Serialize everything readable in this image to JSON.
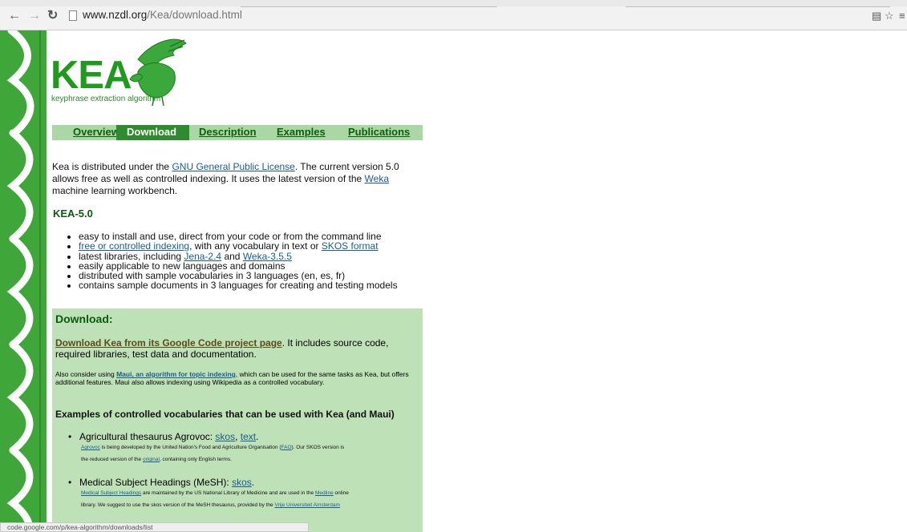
{
  "browser": {
    "url_host": "www.nzdl.org",
    "url_path": "/Kea/download.html"
  },
  "logo": {
    "title": "KEA",
    "subtitle": "keyphrase extraction algorithm"
  },
  "nav": {
    "overview": "Overview",
    "download": "Download",
    "description": "Description",
    "examples": "Examples",
    "publications": "Publications"
  },
  "intro": {
    "p1": "Kea is distributed under the ",
    "license_link": "GNU General Public License",
    "p2": ". The current version 5.0 allows free as well as controlled indexing. It uses the latest version of the ",
    "weka_link": "Weka",
    "p3": " machine learning workbench."
  },
  "kea50": {
    "heading": "KEA-5.0",
    "items": [
      {
        "text": "easy to install and use, direct from your code or from the command line"
      },
      {
        "link": "free or controlled indexing",
        "mid": ", with any vocabulary in text or ",
        "link2": "SKOS format"
      },
      {
        "pre": "latest libraries, including ",
        "link": "Jena-2.4",
        "mid": " and ",
        "link2": "Weka-3.5.5"
      },
      {
        "text": "easily applicable to new languages and domains"
      },
      {
        "text": "distributed with sample vocabularies in 3 languages (en, es, fr)"
      },
      {
        "text": "contains sample documents in 3 languages for creating and testing models"
      }
    ]
  },
  "download": {
    "title": "Download:",
    "link": "Download Kea from its Google Code project page",
    "rest": ". It includes source code, required libraries, test data and documentation.",
    "also_pre": "Also consider using ",
    "also_link": "Maui, an algorithm for topic indexing",
    "also_rest": ", which can be used for the same tasks as Kea, but offers additional features. Maui also allows indexing using Wikipedia as a controlled vocabulary.",
    "examples_heading": "Examples of controlled vocabularies that can be used with Kea (and Maui)",
    "vocabs": [
      {
        "name": "Agricultural thesaurus Agrovoc: ",
        "link1": "skos",
        "sep": ", ",
        "link2": "text",
        "end": ".",
        "d1_link": "Agrovoc",
        "d1": " is being developed by the United Nation's Food and Agriculture Organisation (",
        "d1_link2": "FAO",
        "d1_end": "). Our SKOS version is",
        "d2": "the reduced version of the ",
        "d2_link": "original",
        "d2_end": ", containing only English terms."
      },
      {
        "name": "Medical Subject Headings (MeSH): ",
        "link1": "skos",
        "end": ".",
        "d1_link": "Medical Subject Headings",
        "d1": " are maintained by the US National Library of Medicine and are used in the ",
        "d1_link2": "Medline",
        "d1_end": " online",
        "d2": "library. We suggest to use the skos version of the MeSH thesaurus, provided by the ",
        "d2_link": "Vrije Universiteit Amsterdam",
        "d2_end": ""
      }
    ]
  },
  "status": {
    "text": "code.google.com/p/kea-algorithm/downloads/list"
  }
}
